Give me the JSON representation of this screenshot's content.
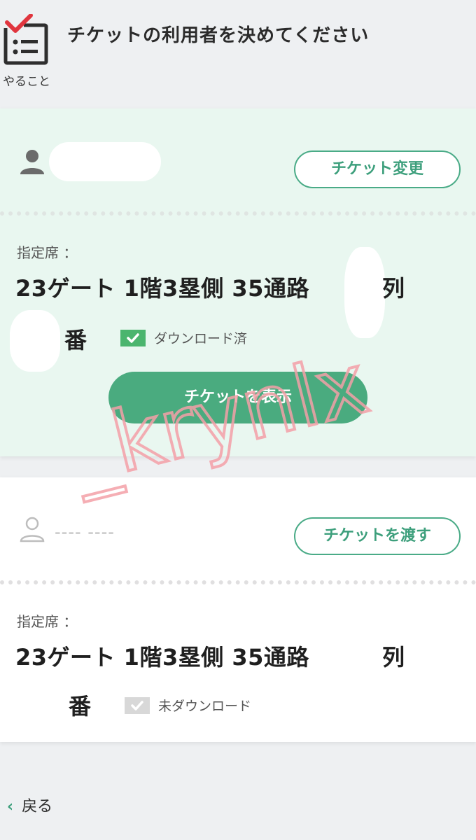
{
  "header": {
    "todo_caption": "やること",
    "title": "チケットの利用者を決めてください"
  },
  "tickets": [
    {
      "user_name": "",
      "action_label": "チケット変更",
      "seat_label": "指定席 ：",
      "seat_line1": "23ゲート 1階3塁側 35通路",
      "seat_row_suffix": "列",
      "seat_num_suffix": "番",
      "download_status": "ダウンロード済",
      "show_button_label": "チケットを表示"
    },
    {
      "user_placeholder": "---- ----",
      "action_label": "チケットを渡す",
      "seat_label": "指定席 ：",
      "seat_line1": "23ゲート 1階3塁側 35通路",
      "seat_row_suffix": "列",
      "seat_num_suffix": "番",
      "download_status": "未ダウンロード"
    }
  ],
  "footer": {
    "back_label": "戻る"
  },
  "watermark": {
    "text": "_krynlx",
    "color": "#f4a0a8"
  },
  "colors": {
    "accent": "#4aab7f",
    "card_active_bg": "#e9f7f0",
    "check_done": "#4bb56e",
    "check_pending": "#d8d8d8",
    "todo_icon_check": "#e0353e"
  }
}
